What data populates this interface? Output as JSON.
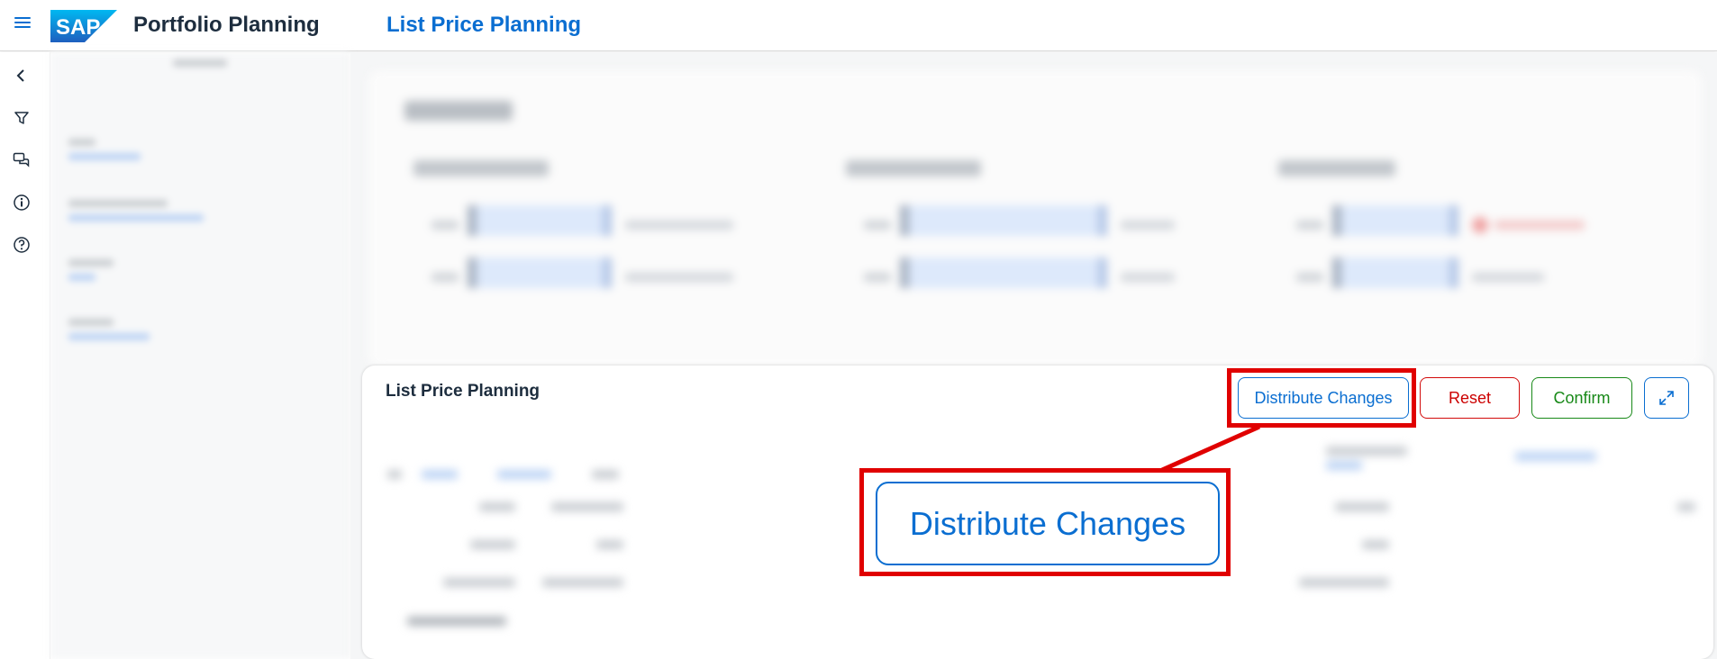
{
  "shell": {
    "app_title": "Portfolio Planning",
    "app_subtitle": "List Price Planning",
    "logo_text": "SAP"
  },
  "rail": {
    "icons": [
      "collapse-icon",
      "filter-icon",
      "chat-icon",
      "info-icon",
      "help-icon"
    ]
  },
  "section": {
    "title": "List Price Planning"
  },
  "toolbar": {
    "distribute_label": "Distribute Changes",
    "reset_label": "Reset",
    "confirm_label": "Confirm",
    "expand_icon": "expand-icon"
  },
  "annotation": {
    "zoom_label": "Distribute Changes"
  },
  "colors": {
    "brand": "#0a6ed1",
    "reset": "#d20a0a",
    "confirm": "#188918",
    "highlight": "#e00000"
  }
}
